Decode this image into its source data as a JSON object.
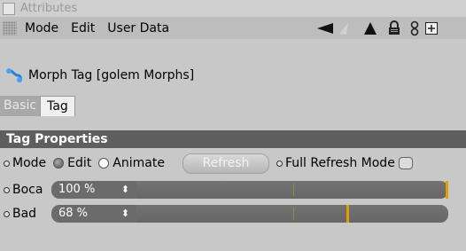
{
  "window": {
    "title": "Attributes"
  },
  "menubar": {
    "items": [
      "Mode",
      "Edit",
      "User Data"
    ]
  },
  "tag": {
    "title": "Morph Tag [golem Morphs]"
  },
  "tabs": {
    "basic": "Basic",
    "tag": "Tag"
  },
  "section": {
    "title": "Tag Properties"
  },
  "mode_row": {
    "label": "Mode",
    "edit_label": "Edit",
    "animate_label": "Animate",
    "refresh_label": "Refresh",
    "full_refresh_label": "Full Refresh Mode",
    "selected": "Edit"
  },
  "sliders": [
    {
      "label": "Boca",
      "value_text": "100 %",
      "value": 1.0
    },
    {
      "label": "Bad",
      "value_text": "68 %",
      "value": 0.68
    }
  ],
  "colors": {
    "accent": "#e0a000",
    "section_bg": "#5e5e5e"
  }
}
